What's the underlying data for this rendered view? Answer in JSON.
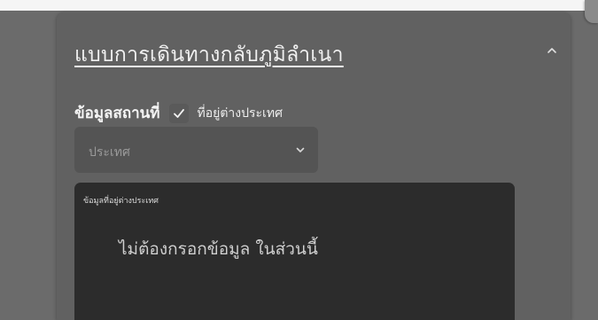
{
  "section": {
    "title": "แบบการเดินทางกลับภูมิลำเนา",
    "collapse_icon": "chevron-up-icon"
  },
  "location": {
    "label": "ข้อมูลสถานที่",
    "abroad_checkbox": {
      "checked": true,
      "label": "ที่อยู่ต่างประเทศ"
    }
  },
  "country_select": {
    "placeholder": "ประเทศ",
    "icon": "chevron-down-icon"
  },
  "abroad_address": {
    "label": "ข้อมูลที่อยู่ต่างประเทศ",
    "value": "ไม่ต้องกรอกข้อมูล ในส่วนนี้"
  },
  "colors": {
    "page_background": "#6b6b6b",
    "card_background": "#616161",
    "textarea_background": "#2c2c2c"
  }
}
